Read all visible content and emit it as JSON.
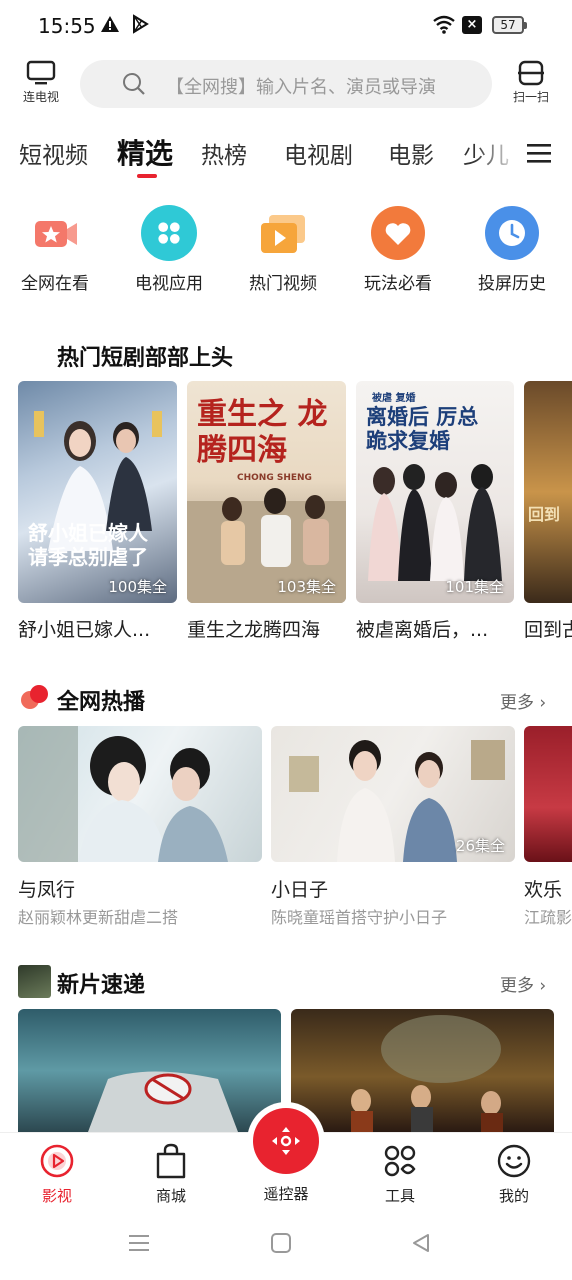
{
  "status_bar": {
    "time": "15:55",
    "battery": "57"
  },
  "header": {
    "left_button_label": "连电视",
    "search_placeholder": "【全网搜】输入片名、演员或导演",
    "right_button_label": "扫一扫"
  },
  "tabs": [
    "短视频",
    "精选",
    "热榜",
    "电视剧",
    "电影",
    "少儿"
  ],
  "active_tab": "精选",
  "quick_entries": [
    {
      "label": "全网在看",
      "icon": "video-camera-star-icon",
      "color": "#f4786a"
    },
    {
      "label": "电视应用",
      "icon": "app-grid-icon",
      "color": "#2fc9d6"
    },
    {
      "label": "热门视频",
      "icon": "video-play-icon",
      "color": "#f6a53b"
    },
    {
      "label": "玩法必看",
      "icon": "heart-icon",
      "color": "#f27a3c"
    },
    {
      "label": "投屏历史",
      "icon": "clock-icon",
      "color": "#4a90e8"
    }
  ],
  "short_drama": {
    "title": "热门短剧部部上头",
    "cards": [
      {
        "title": "舒小姐已嫁人...",
        "episodes": "100集全",
        "poster_text": "舒小姐已嫁人 请季总别虐了"
      },
      {
        "title": "重生之龙腾四海",
        "episodes": "103集全",
        "poster_text": "重生之 龙腾四海",
        "poster_subtext": "CHONG SHENG"
      },
      {
        "title": "被虐离婚后，...",
        "episodes": "101集全",
        "poster_text": "离婚后 厉总跪求复婚",
        "poster_subtext": "被虐 复婚"
      },
      {
        "title": "回到古",
        "episodes": "",
        "poster_text": "回到"
      }
    ]
  },
  "hot_section": {
    "title": "全网热播",
    "more": "更多",
    "items": [
      {
        "title": "与凤行",
        "subtitle": "赵丽颖林更新甜虐二搭",
        "episodes": ""
      },
      {
        "title": "小日子",
        "subtitle": "陈晓童瑶首搭守护小日子",
        "episodes": "26集全"
      },
      {
        "title": "欢乐",
        "subtitle": "江疏影",
        "episodes": ""
      }
    ]
  },
  "new_section": {
    "title": "新片速递",
    "more": "更多"
  },
  "bottom_nav": {
    "items": [
      {
        "label": "影视",
        "icon": "play-circle-icon",
        "active": true
      },
      {
        "label": "商城",
        "icon": "shopping-bag-icon",
        "active": false
      },
      {
        "label": "遥控器",
        "icon": "remote-control-icon",
        "active": false
      },
      {
        "label": "工具",
        "icon": "tools-grid-icon",
        "active": false
      },
      {
        "label": "我的",
        "icon": "smiley-face-icon",
        "active": false
      }
    ]
  },
  "colors": {
    "accent": "#e8232f"
  }
}
